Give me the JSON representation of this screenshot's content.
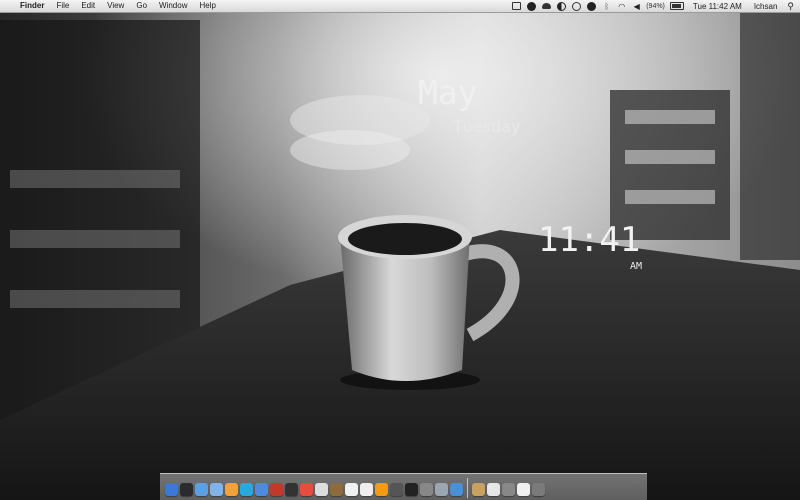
{
  "menubar": {
    "apple_icon": "apple-icon",
    "app_name": "Finder",
    "menus": [
      "File",
      "Edit",
      "View",
      "Go",
      "Window",
      "Help"
    ],
    "battery_text": "(94%)",
    "clock": "Tue 11:42 AM",
    "user": "Ichsan",
    "search_icon": "spotlight-icon"
  },
  "widget": {
    "month": "May",
    "day": "22",
    "weekday": "Tuesday",
    "time": "11:41",
    "ampm": "AM"
  },
  "dock": {
    "icons": [
      "finder-icon",
      "dashboard-icon",
      "safari-icon",
      "itunes-icon",
      "adium-icon",
      "skype-icon",
      "chat-icon",
      "photo-icon",
      "steam-icon",
      "calendar-icon",
      "preview-icon",
      "iphoto-icon",
      "ical-icon",
      "textedit-icon",
      "vlc-icon",
      "xcode-icon",
      "terminal-icon",
      "chess-icon",
      "utilities-icon",
      "app-icon"
    ],
    "stack_icons": [
      "downloads-stack-icon",
      "documents-stack-icon",
      "applications-stack-icon",
      "desktop-stack-icon",
      "trash-icon"
    ]
  }
}
